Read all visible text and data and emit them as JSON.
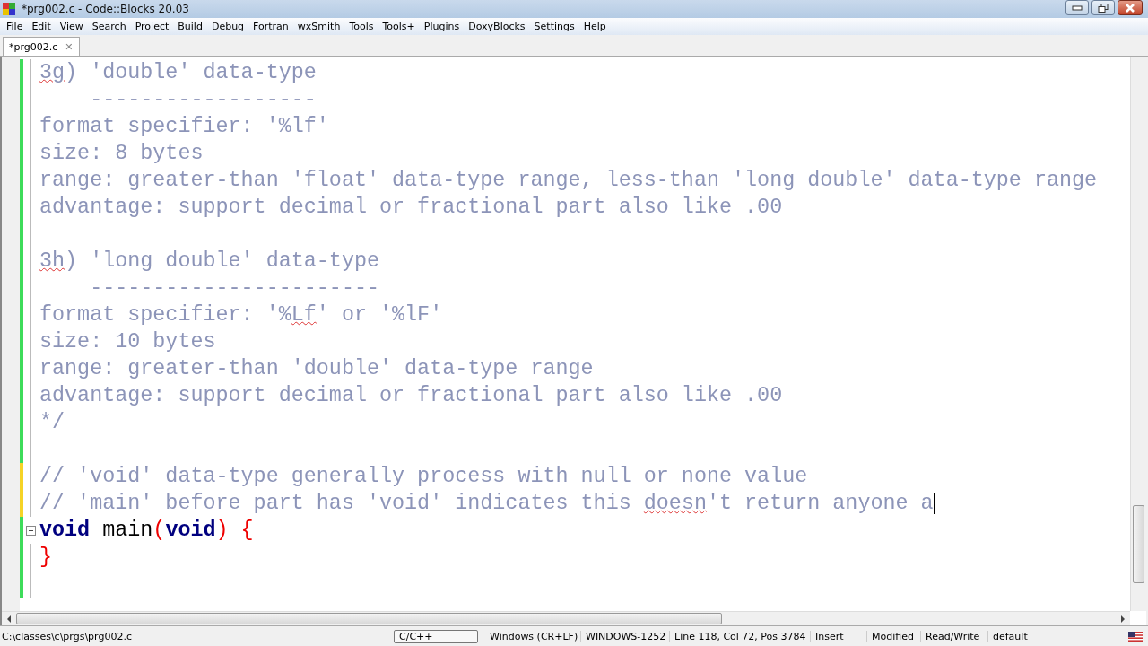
{
  "window": {
    "title": "*prg002.c - Code::Blocks 20.03"
  },
  "menu": [
    "File",
    "Edit",
    "View",
    "Search",
    "Project",
    "Build",
    "Debug",
    "Fortran",
    "wxSmith",
    "Tools",
    "Tools+",
    "Plugins",
    "DoxyBlocks",
    "Settings",
    "Help"
  ],
  "tabs": [
    {
      "label": "*prg002.c",
      "close": "✕",
      "selected": true
    }
  ],
  "editor": {
    "lines": [
      {
        "unsaved": false,
        "tokens": [
          {
            "text": "3g",
            "kind": "spell"
          },
          {
            "text": ") 'double' data-type",
            "kind": "comment"
          }
        ]
      },
      {
        "unsaved": false,
        "tokens": [
          {
            "text": "    ------------------",
            "kind": "comment"
          }
        ]
      },
      {
        "unsaved": false,
        "tokens": [
          {
            "text": "format specifier: '%lf'",
            "kind": "comment"
          }
        ]
      },
      {
        "unsaved": false,
        "tokens": [
          {
            "text": "size: 8 bytes",
            "kind": "comment"
          }
        ]
      },
      {
        "unsaved": false,
        "tokens": [
          {
            "text": "range: greater-than 'float' data-type range, less-than 'long double' data-type range",
            "kind": "comment"
          }
        ]
      },
      {
        "unsaved": false,
        "tokens": [
          {
            "text": "advantage: support decimal or fractional part also like .00",
            "kind": "comment"
          }
        ]
      },
      {
        "unsaved": false
      },
      {
        "unsaved": false,
        "tokens": [
          {
            "text": "3h",
            "kind": "spell"
          },
          {
            "text": ") 'long double' data-type",
            "kind": "comment"
          }
        ]
      },
      {
        "unsaved": false,
        "tokens": [
          {
            "text": "    -----------------------",
            "kind": "comment"
          }
        ]
      },
      {
        "unsaved": false,
        "tokens": [
          {
            "text": "format specifier: '%",
            "kind": "comment"
          },
          {
            "text": "Lf",
            "kind": "spell"
          },
          {
            "text": "' or '%lF'",
            "kind": "comment"
          }
        ]
      },
      {
        "unsaved": false,
        "tokens": [
          {
            "text": "size: 10 bytes",
            "kind": "comment"
          }
        ]
      },
      {
        "unsaved": false,
        "tokens": [
          {
            "text": "range: greater-than 'double' data-type range",
            "kind": "comment"
          }
        ]
      },
      {
        "unsaved": false,
        "tokens": [
          {
            "text": "advantage: support decimal or fractional part also like .00",
            "kind": "comment"
          }
        ]
      },
      {
        "unsaved": false,
        "tokens": [
          {
            "text": "*/",
            "kind": "comment"
          }
        ]
      },
      {
        "unsaved": false
      },
      {
        "unsaved": true,
        "tokens": [
          {
            "text": "// 'void' data-type generally process with null or none value",
            "kind": "comment"
          }
        ]
      },
      {
        "unsaved": true,
        "caret": true,
        "tokens": [
          {
            "text": "// 'main' before part has 'void' indicates this ",
            "kind": "comment"
          },
          {
            "text": "doesn",
            "kind": "spell"
          },
          {
            "text": "'t return anyone a",
            "kind": "comment"
          }
        ]
      },
      {
        "unsaved": false,
        "fold": true,
        "tokens": [
          {
            "text": "void",
            "kind": "keyword"
          },
          {
            "text": " main",
            "kind": "plain"
          },
          {
            "text": "(",
            "kind": "brace"
          },
          {
            "text": "void",
            "kind": "keyword"
          },
          {
            "text": ") {",
            "kind": "brace"
          }
        ]
      },
      {
        "unsaved": false,
        "tokens": [
          {
            "text": "}",
            "kind": "brace"
          }
        ]
      },
      {
        "unsaved": false
      }
    ]
  },
  "status_bar": {
    "path": "C:\\classes\\c\\prgs\\prg002.c",
    "language": "C/C++",
    "eol": "Windows (CR+LF)",
    "encoding": "WINDOWS-1252",
    "position": "Line 118, Col 72, Pos 3784",
    "mode": "Insert",
    "modified": "Modified",
    "access": "Read/Write",
    "profile": "default"
  }
}
